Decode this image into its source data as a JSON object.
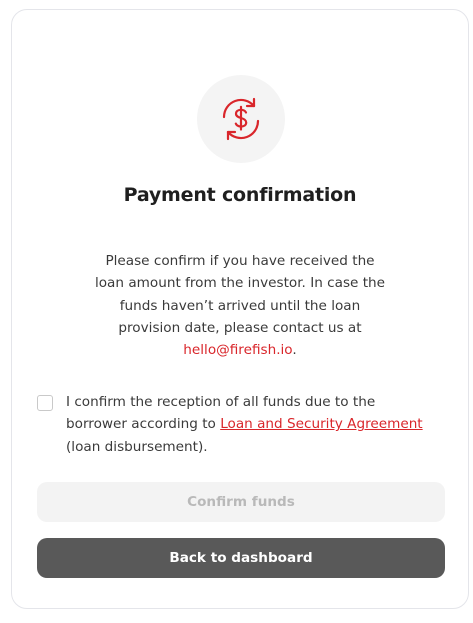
{
  "modal": {
    "title": "Payment confirmation",
    "description_lines": [
      "Please confirm if you have received the",
      "loan amount from the investor. In case the",
      "funds haven’t arrived until the loan",
      "provision date, please contact us at"
    ],
    "email": "hello@firefish.io",
    "email_suffix": ".",
    "icon": "dollar-exchange-icon",
    "accent_color": "#d9262b"
  },
  "confirmation": {
    "checked": false,
    "text_line1": "I confirm the reception of all funds due to the",
    "text_line2_prefix": "borrower according to ",
    "link_text": "Loan and Security Agreement",
    "text_line3": "(loan disbursement)."
  },
  "buttons": {
    "confirm_label": "Confirm funds",
    "back_label": "Back to dashboard"
  }
}
